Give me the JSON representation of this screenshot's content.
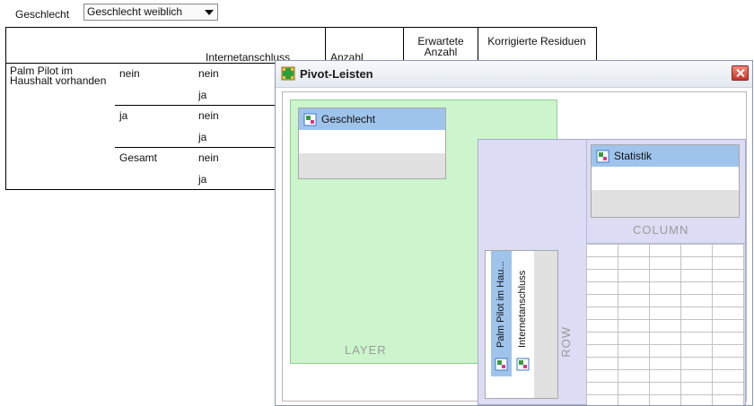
{
  "layer_selector": {
    "label": "Geschlecht",
    "selected": "Geschlecht weiblich"
  },
  "pivot_table": {
    "col_headers": [
      "Internetanschluss",
      "Anzahl",
      "Erwartete Anzahl",
      "Korrigierte Residuen"
    ],
    "row_dim_label": "Palm Pilot im Haushalt vorhanden",
    "groups": [
      {
        "label": "nein",
        "rows": [
          "nein",
          "ja"
        ]
      },
      {
        "label": "ja",
        "rows": [
          "nein",
          "ja"
        ]
      },
      {
        "label": "Gesamt",
        "rows": [
          "nein",
          "ja"
        ]
      }
    ]
  },
  "dialog": {
    "title": "Pivot-Leisten",
    "zones": {
      "layer": {
        "title": "LAYER",
        "items": [
          "Geschlecht"
        ]
      },
      "column": {
        "title": "COLUMN",
        "items": [
          "Statistik"
        ]
      },
      "row": {
        "title": "ROW",
        "items": [
          "Palm Pilot im Hau...",
          "Internetanschluss"
        ]
      }
    }
  },
  "icons": {
    "title_icon": "pivot-icon",
    "dimension_icon": "dimension-icon",
    "close_icon": "close-icon"
  },
  "colors": {
    "layer_zone": "#ccf5cc",
    "row_column_zone": "#dcdcf4",
    "selected_item": "#9fc4ec",
    "close_button": "#c7342a"
  }
}
